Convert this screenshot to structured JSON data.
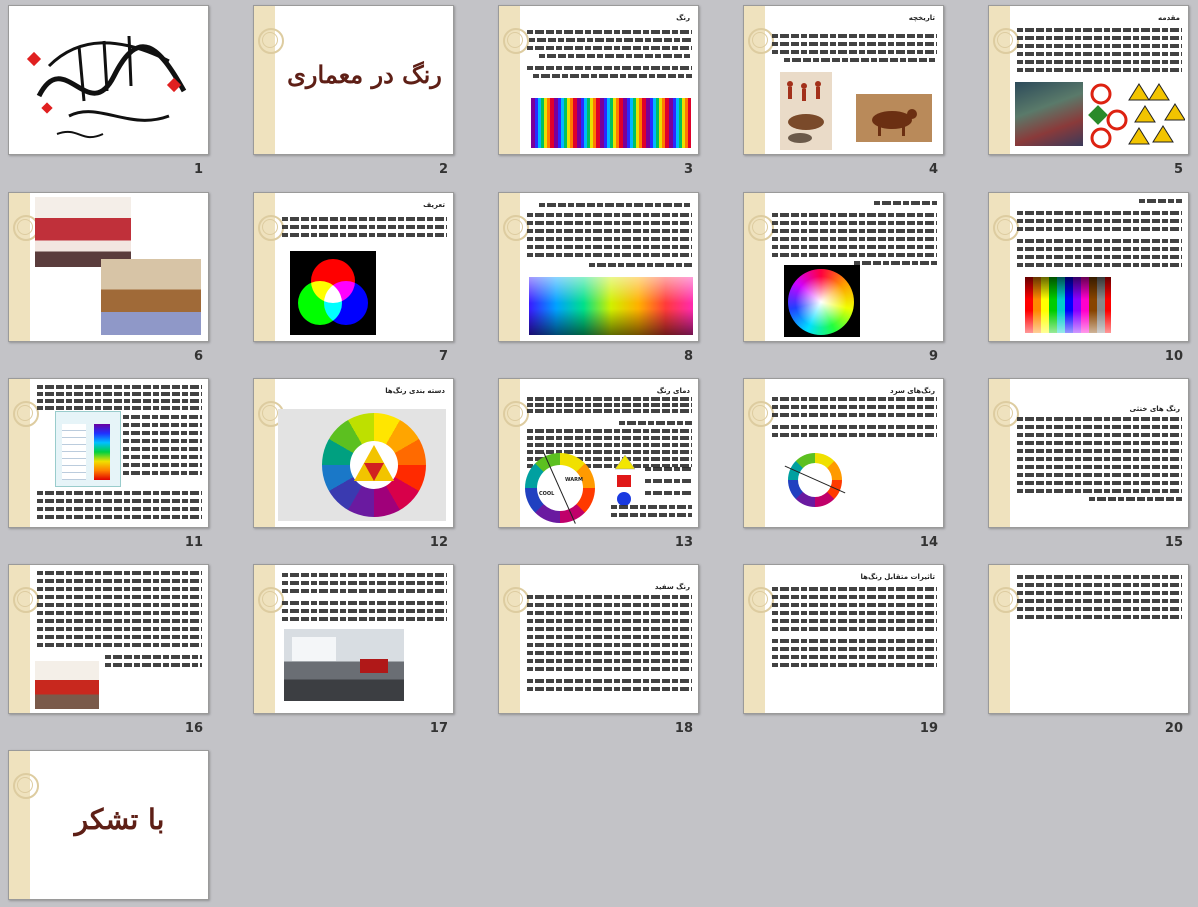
{
  "slides": [
    {
      "number": "1",
      "title": ""
    },
    {
      "number": "2",
      "title": "رنگ در معماری"
    },
    {
      "number": "3",
      "title": "رنگ"
    },
    {
      "number": "4",
      "title": "تاریخچه"
    },
    {
      "number": "5",
      "title": "مقدمه"
    },
    {
      "number": "6",
      "title": ""
    },
    {
      "number": "7",
      "title": "تعریف"
    },
    {
      "number": "8",
      "title": ""
    },
    {
      "number": "9",
      "title": ""
    },
    {
      "number": "10",
      "title": ""
    },
    {
      "number": "11",
      "title": ""
    },
    {
      "number": "12",
      "title": "دسته بندی رنگ‌ها"
    },
    {
      "number": "13",
      "title": "دمای رنگ"
    },
    {
      "number": "14",
      "title": "رنگ‌های سرد"
    },
    {
      "number": "15",
      "title": "رنگ های خنثی"
    },
    {
      "number": "16",
      "title": ""
    },
    {
      "number": "17",
      "title": ""
    },
    {
      "number": "18",
      "title": "رنگ سفید"
    },
    {
      "number": "19",
      "title": "تاثیرات متقابل رنگ‌ها"
    },
    {
      "number": "20",
      "title": ""
    },
    {
      "number": "21",
      "title": "با تشکر"
    }
  ],
  "wheel_labels": {
    "warm": "WARM",
    "cool": "COOL"
  },
  "colors": {
    "title_brown": "#5e1f16",
    "sidebar_beige": "#efe2be",
    "panel_bg": "#c3c3c7"
  }
}
